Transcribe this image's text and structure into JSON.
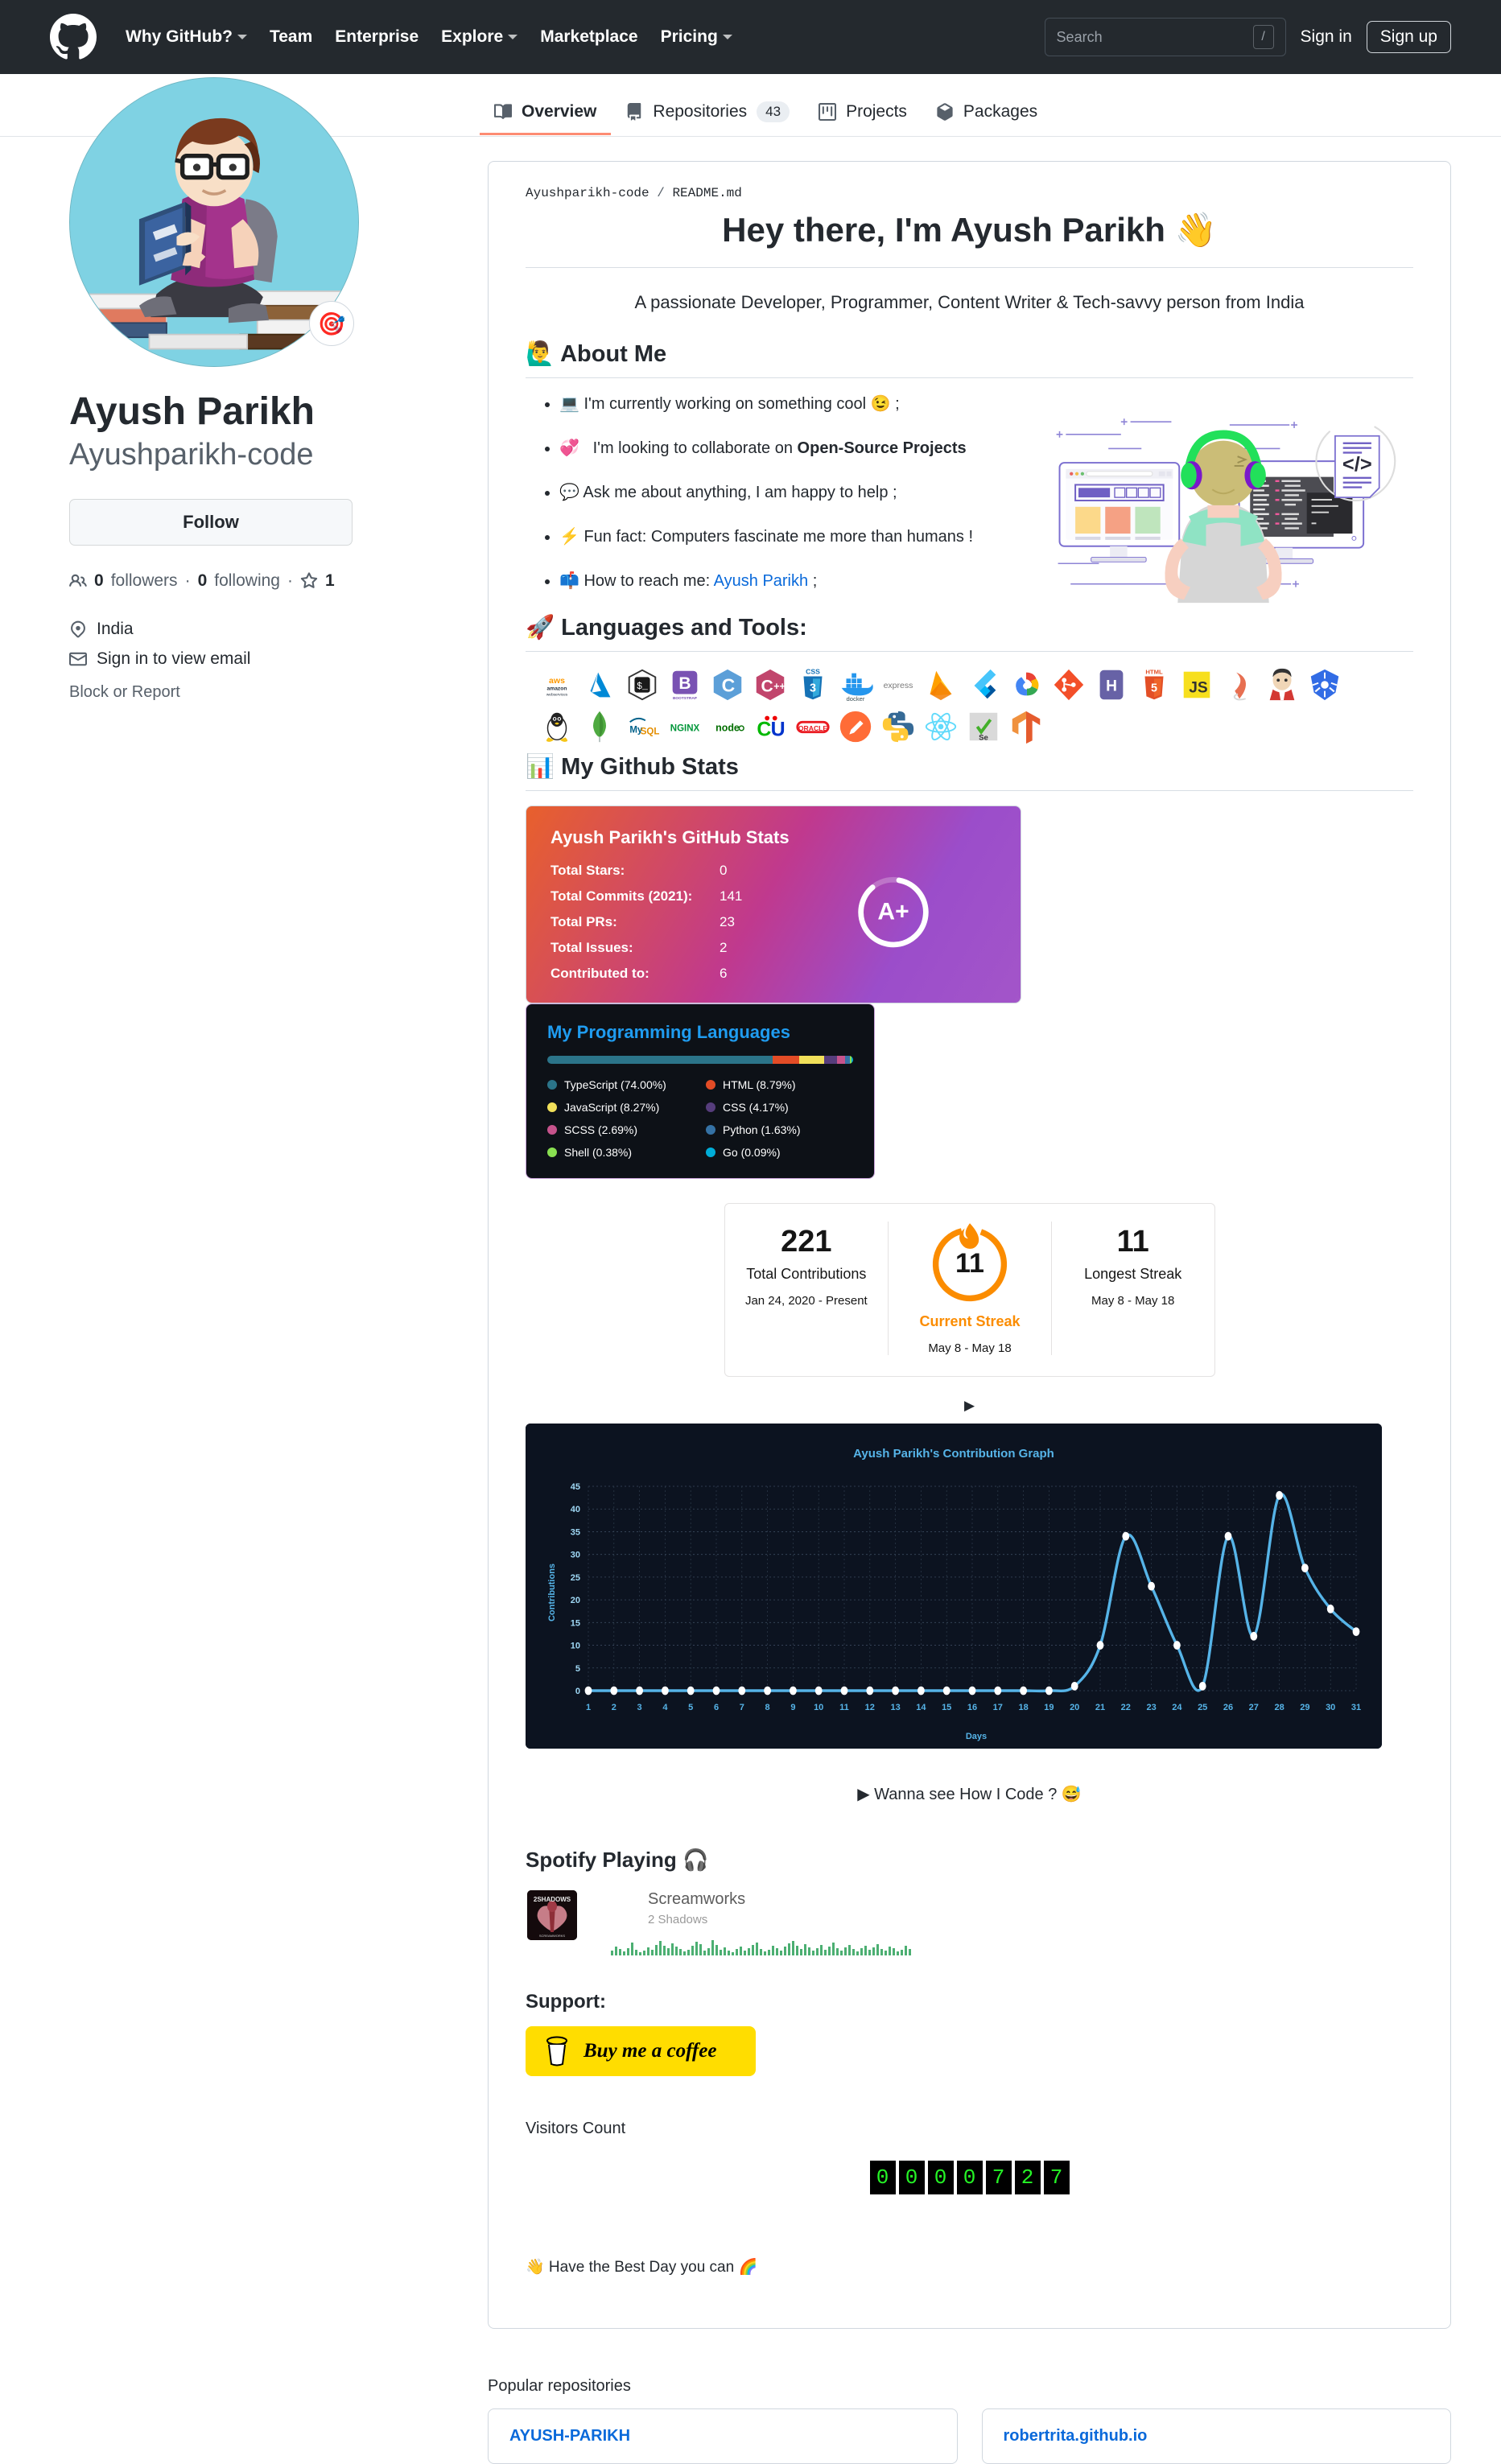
{
  "header": {
    "logo_icon": "github-mark-icon",
    "nav": [
      {
        "label": "Why GitHub?",
        "has_caret": true
      },
      {
        "label": "Team",
        "has_caret": false
      },
      {
        "label": "Enterprise",
        "has_caret": false
      },
      {
        "label": "Explore",
        "has_caret": true
      },
      {
        "label": "Marketplace",
        "has_caret": false
      },
      {
        "label": "Pricing",
        "has_caret": true
      }
    ],
    "search_placeholder": "Search",
    "search_value": "",
    "search_hotkey": "/",
    "sign_in": "Sign in",
    "sign_up": "Sign up"
  },
  "tabs": [
    {
      "label": "Overview",
      "icon": "book-icon",
      "counter": null,
      "active": true
    },
    {
      "label": "Repositories",
      "icon": "repo-icon",
      "counter": "43",
      "active": false
    },
    {
      "label": "Projects",
      "icon": "project-icon",
      "counter": null,
      "active": false
    },
    {
      "label": "Packages",
      "icon": "package-icon",
      "counter": null,
      "active": false
    }
  ],
  "profile": {
    "avatar_icon": "avatar-student-reading",
    "status_emoji": "🎯",
    "name": "Ayush Parikh",
    "login": "Ayushparikh-code",
    "follow_label": "Follow",
    "followers_count": "0",
    "followers_label": "followers",
    "following_count": "0",
    "following_label": "following",
    "stars_count": "1",
    "location": "India",
    "email_line": "Sign in to view email",
    "block_or_report": "Block or Report"
  },
  "readme": {
    "path_owner": "Ayushparikh-code",
    "path_sep": "/",
    "path_file": "README.md",
    "title": "Hey there, I'm Ayush Parikh 👋",
    "subtitle": "A passionate Developer, Programmer, Content Writer & Tech-savvy person from India",
    "about_heading": "🙋‍♂️ About Me",
    "about_items": [
      {
        "emoji": "💻",
        "text": "I'm currently working on something cool ",
        "emoji_end": "😉",
        "suffix": " ;"
      },
      {
        "emoji": "💞️",
        "text": "I'm looking to collaborate on ",
        "bold": "Open-Source Projects",
        "suffix": ""
      },
      {
        "emoji": "💬",
        "text": "Ask me about anything, I am happy to help ;",
        "suffix": ""
      },
      {
        "emoji": "⚡",
        "text": "Fun fact: Computers fascinate me more than humans !",
        "suffix": ""
      },
      {
        "emoji": "📫",
        "text": "How to reach me: ",
        "link": "Ayush Parikh",
        "suffix": " ;"
      }
    ],
    "tools_heading": "🚀 Languages and Tools:",
    "tools_row1": [
      "aws-icon",
      "azure-icon",
      "bash-icon",
      "bootstrap-icon",
      "c-icon",
      "cplusplus-icon",
      "css3-icon",
      "docker-icon",
      "express-icon",
      "firebase-icon",
      "flutter-icon",
      "gcp-icon",
      "git-icon",
      "heroku-icon",
      "html5-icon",
      "javascript-icon",
      "java-icon",
      "jenkins-icon",
      "kubernetes-icon"
    ],
    "tools_row2": [
      "linux-icon",
      "mongodb-icon",
      "mysql-icon",
      "nginx-icon",
      "nodejs-icon",
      "csharp-icon",
      "oracle-icon",
      "postman-icon",
      "python-icon",
      "react-icon",
      "selenium-icon",
      "tensorflow-icon"
    ],
    "stats_heading": "📊 My Github Stats",
    "wanna_see": "▶ Wanna see How I Code ? 😅",
    "collapse_arrow": "▶",
    "spotify_heading": "Spotify Playing 🎧",
    "spotify_track": "Screamworks",
    "spotify_artist": "2 Shadows",
    "spotify_album_text": "2SHADOWS",
    "support_heading": "Support:",
    "bmc_label": "Buy me a coffee",
    "visitors_heading": "Visitors Count",
    "visitors_digits": [
      "0",
      "0",
      "0",
      "0",
      "7",
      "2",
      "7"
    ],
    "best_day": "👋 Have the Best Day you can 🌈"
  },
  "github_stats_card": {
    "title": "Ayush Parikh's GitHub Stats",
    "rows": [
      {
        "label": "Total Stars:",
        "value": "0"
      },
      {
        "label": "Total Commits (2021):",
        "value": "141"
      },
      {
        "label": "Total PRs:",
        "value": "23"
      },
      {
        "label": "Total Issues:",
        "value": "2"
      },
      {
        "label": "Contributed to:",
        "value": "6"
      }
    ],
    "grade": "A+",
    "grade_percent": 86
  },
  "streak_card": {
    "total_contributions_value": "221",
    "total_contributions_label": "Total Contributions",
    "total_contributions_range": "Jan 24, 2020 - Present",
    "current_streak_value": "11",
    "current_streak_label": "Current Streak",
    "current_streak_range": "May 8 - May 18",
    "longest_streak_value": "11",
    "longest_streak_label": "Longest Streak",
    "longest_streak_range": "May 8 - May 18",
    "accent_color": "#fb8c00"
  },
  "chart_data": {
    "type": "line",
    "title": "Ayush Parikh's Contribution Graph",
    "xlabel": "Days",
    "ylabel": "Contributions",
    "x": [
      1,
      2,
      3,
      4,
      5,
      6,
      7,
      8,
      9,
      10,
      11,
      12,
      13,
      14,
      15,
      16,
      17,
      18,
      19,
      20,
      21,
      22,
      23,
      24,
      25,
      26,
      27,
      28,
      29,
      30,
      31
    ],
    "values": [
      0,
      0,
      0,
      0,
      0,
      0,
      0,
      0,
      0,
      0,
      0,
      0,
      0,
      0,
      0,
      0,
      0,
      0,
      0,
      1,
      10,
      34,
      23,
      10,
      1,
      34,
      12,
      43,
      27,
      18,
      13
    ],
    "ylim": [
      0,
      45
    ],
    "yticks": [
      0,
      5,
      10,
      15,
      20,
      25,
      30,
      35,
      40,
      45
    ],
    "xticks": [
      1,
      2,
      3,
      4,
      5,
      6,
      7,
      8,
      9,
      10,
      11,
      12,
      13,
      14,
      15,
      16,
      17,
      18,
      19,
      20,
      21,
      22,
      23,
      24,
      25,
      26,
      27,
      28,
      29,
      30,
      31
    ],
    "line_color": "#56b4e8",
    "marker_color": "#ffffff",
    "background": "#0c1320",
    "grid": true,
    "legend": "none"
  },
  "languages_card": {
    "title": "My Programming Languages",
    "items": [
      {
        "name": "TypeScript (74.00%)",
        "color": "#2b7489",
        "pct": 74.0
      },
      {
        "name": "HTML (8.79%)",
        "color": "#e34c26",
        "pct": 8.79
      },
      {
        "name": "JavaScript (8.27%)",
        "color": "#f1e05a",
        "pct": 8.27
      },
      {
        "name": "CSS (4.17%)",
        "color": "#563d7c",
        "pct": 4.17
      },
      {
        "name": "SCSS (2.69%)",
        "color": "#c6538c",
        "pct": 2.69
      },
      {
        "name": "Python (1.63%)",
        "color": "#3572A5",
        "pct": 1.63
      },
      {
        "name": "Shell (0.38%)",
        "color": "#89e051",
        "pct": 0.38
      },
      {
        "name": "Go (0.09%)",
        "color": "#00ADD8",
        "pct": 0.09
      }
    ],
    "bar_order": [
      "#2b7489",
      "#e34c26",
      "#f1e05a",
      "#563d7c",
      "#c6538c",
      "#3572A5",
      "#89e051",
      "#00ADD8"
    ]
  },
  "popular": {
    "heading": "Popular repositories",
    "repos": [
      {
        "name": "AYUSH-PARIKH"
      },
      {
        "name": "robertrita.github.io"
      }
    ]
  }
}
